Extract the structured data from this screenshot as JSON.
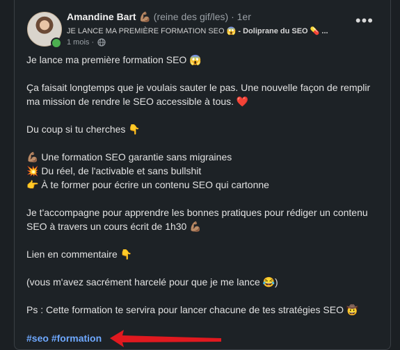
{
  "author": {
    "name": "Amandine Bart",
    "name_emoji": "💪🏽",
    "tagline": "(reine des gif/les)",
    "connection": "· 1er",
    "headline_part1": "JE LANCE MA PREMIÈRE FORMATION SEO 😱",
    "headline_part2": "- Doliprane du SEO 💊 ...",
    "time": "1 mois ·"
  },
  "post": {
    "line1": "Je lance ma première formation SEO 😱",
    "line2": "Ça faisait longtemps que je voulais sauter le pas. Une nouvelle façon de remplir ma mission de rendre le SEO accessible à tous. ❤️",
    "line3": "Du coup si tu cherches 👇",
    "bullet1": "💪🏽 Une formation SEO garantie sans migraines",
    "bullet2": "💥 Du réel, de l'activable et sans bullshit",
    "bullet3": "👉 À te former pour écrire un contenu SEO qui cartonne",
    "line4": "Je t'accompagne pour apprendre les bonnes pratiques pour rédiger un contenu SEO à travers un cours écrit de 1h30 💪🏽",
    "line5": "Lien en commentaire 👇",
    "line6": "(vous m'avez sacrément harcelé pour que je me lance 😂)",
    "line7": "Ps : Cette formation te servira pour lancer chacune de tes stratégies SEO 🤠",
    "hashtag1": "#seo",
    "hashtag2": "#formation"
  },
  "colors": {
    "hashtag": "#6ea8fe",
    "arrow": "#e0191f",
    "presence": "#4caf50"
  }
}
